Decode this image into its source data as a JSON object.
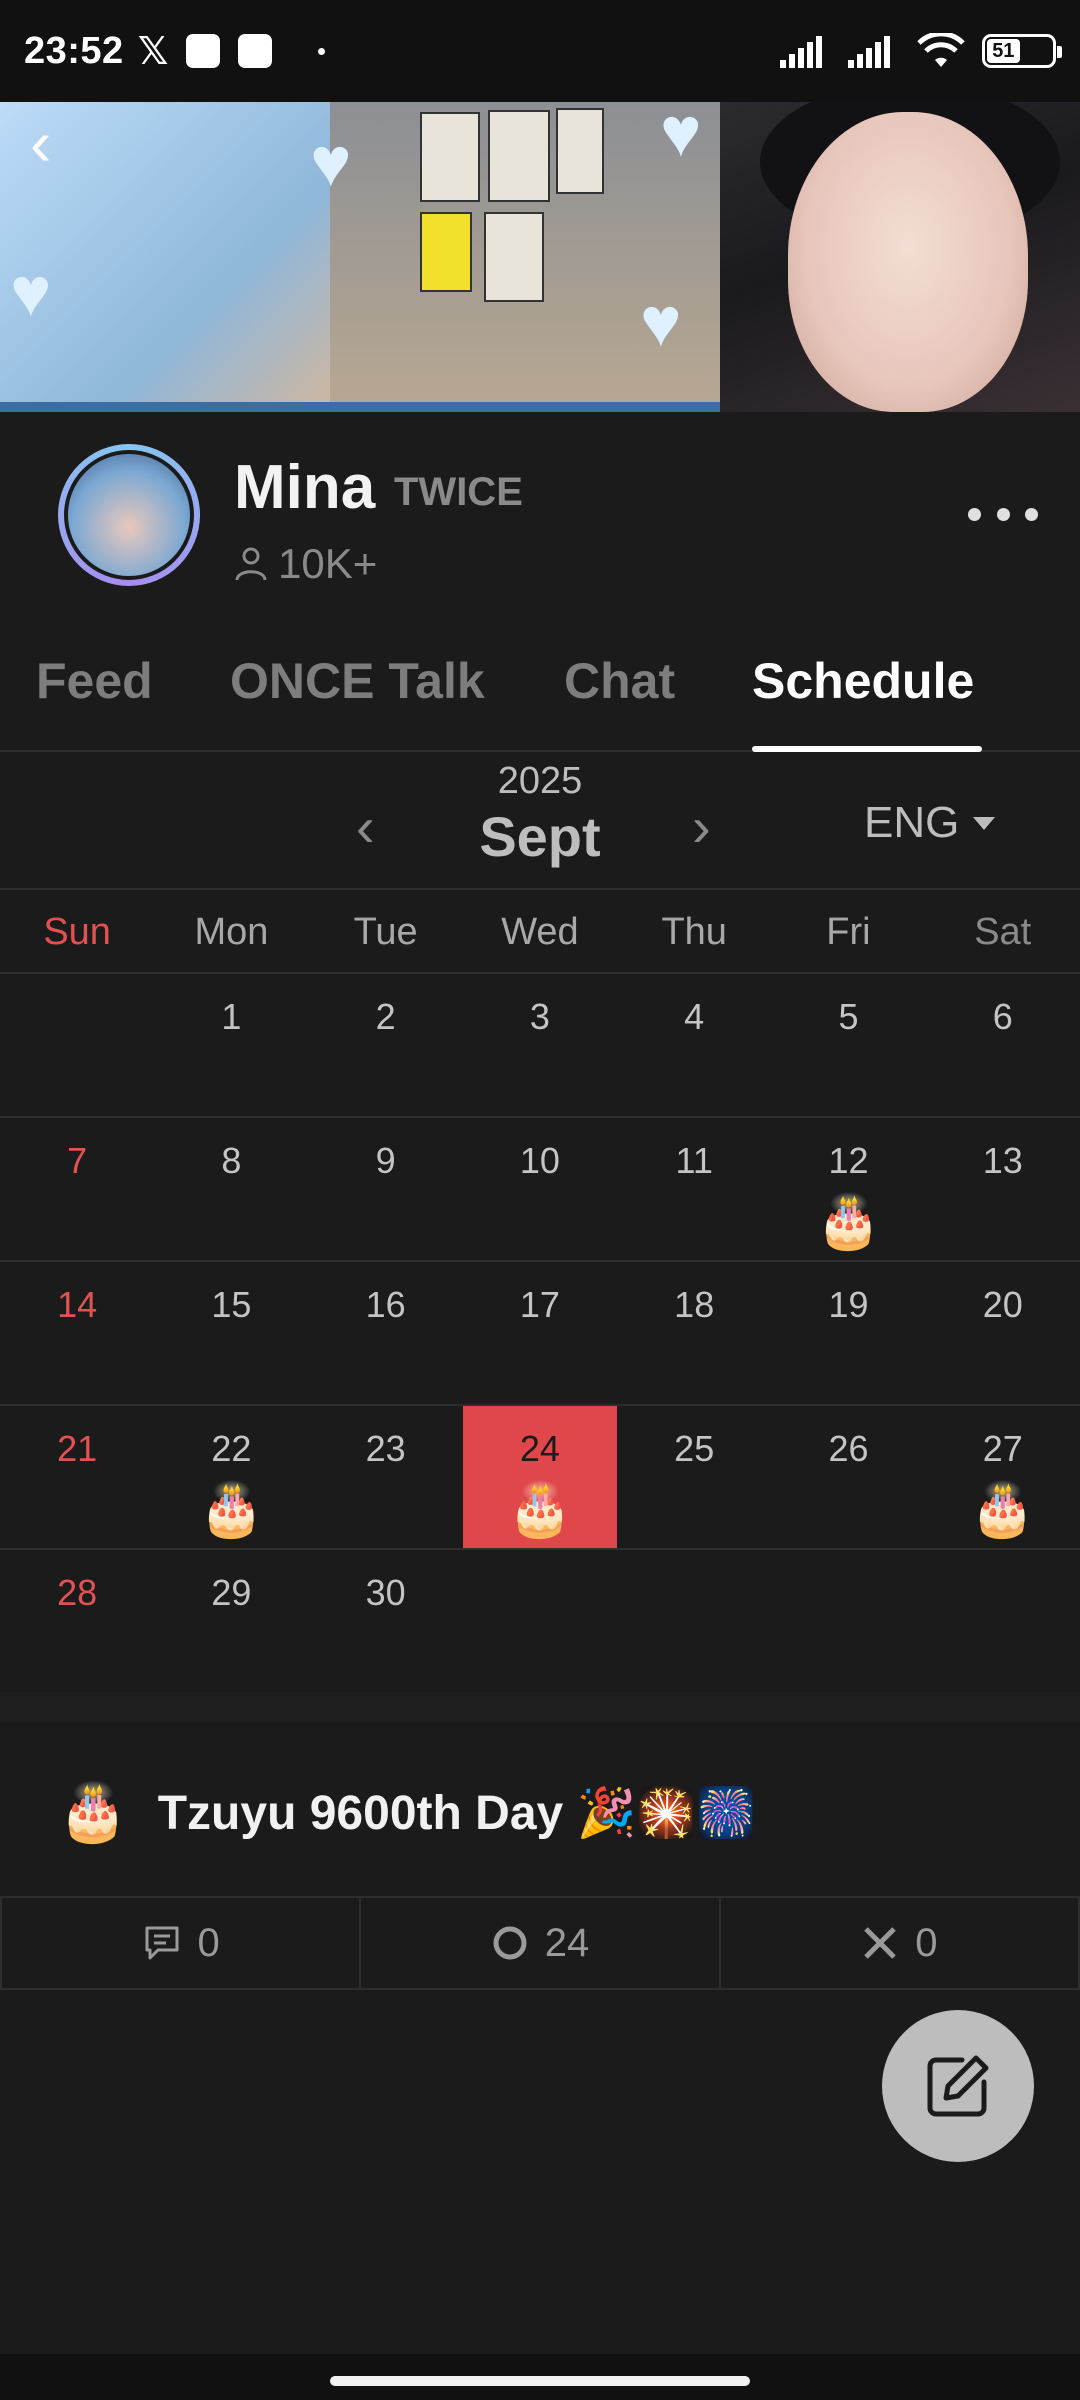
{
  "status": {
    "time": "23:52",
    "x_glyph": "𝕏",
    "battery": "51"
  },
  "profile": {
    "name": "Mina",
    "group": "TWICE",
    "followers": "10K+"
  },
  "tabs": [
    "Feed",
    "ONCE Talk",
    "Chat",
    "Schedule"
  ],
  "calendar": {
    "year": "2025",
    "month": "Sept",
    "language": "ENG",
    "weekdays": [
      "Sun",
      "Mon",
      "Tue",
      "Wed",
      "Thu",
      "Fri",
      "Sat"
    ],
    "weeks": [
      [
        "",
        "1",
        "2",
        "3",
        "4",
        "5",
        "6"
      ],
      [
        "7",
        "8",
        "9",
        "10",
        "11",
        "12",
        "13"
      ],
      [
        "14",
        "15",
        "16",
        "17",
        "18",
        "19",
        "20"
      ],
      [
        "21",
        "22",
        "23",
        "24",
        "25",
        "26",
        "27"
      ],
      [
        "28",
        "29",
        "30",
        "",
        "",
        "",
        ""
      ]
    ],
    "today": "24",
    "event_days": [
      "12",
      "22",
      "24",
      "27"
    ],
    "event_icon": "🎂",
    "colors": {
      "sunday": "#e35252",
      "today": "#e0474a"
    }
  },
  "event": {
    "icon": "🎂",
    "title": "Tzuyu 9600th Day 🎉🎇🎆",
    "comments": "0",
    "yes": "24",
    "no": "0"
  }
}
